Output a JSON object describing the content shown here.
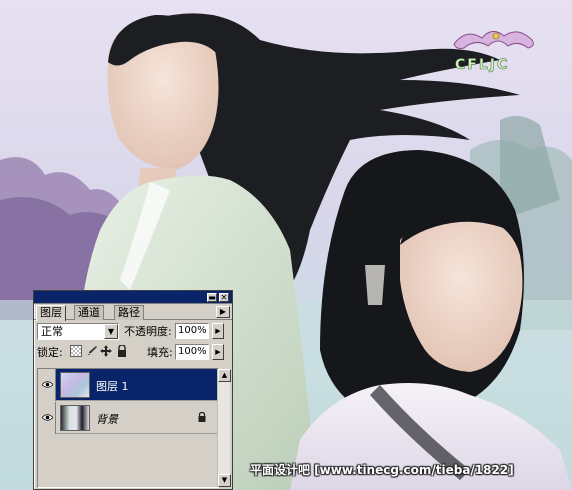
{
  "logo": {
    "text": "CFLJC"
  },
  "watermark": {
    "text": "平面设计吧   [www.tinecg.com/tieba/1822]"
  },
  "palette": {
    "tabs": [
      {
        "label": "图层",
        "active": true
      },
      {
        "label": "通道",
        "active": false
      },
      {
        "label": "路径",
        "active": false
      }
    ],
    "blend_mode": "正常",
    "opacity_label": "不透明度:",
    "opacity_value": "100%",
    "lock_label": "锁定:",
    "fill_label": "填充:",
    "fill_value": "100%",
    "layers": [
      {
        "name": "图层 1",
        "selected": true,
        "visible": true,
        "locked": false
      },
      {
        "name": "背景",
        "selected": false,
        "visible": true,
        "locked": true
      }
    ]
  },
  "colors": {
    "titlebar": "#0a246a",
    "selection": "#0a246a",
    "panel": "#d4d0c8"
  }
}
